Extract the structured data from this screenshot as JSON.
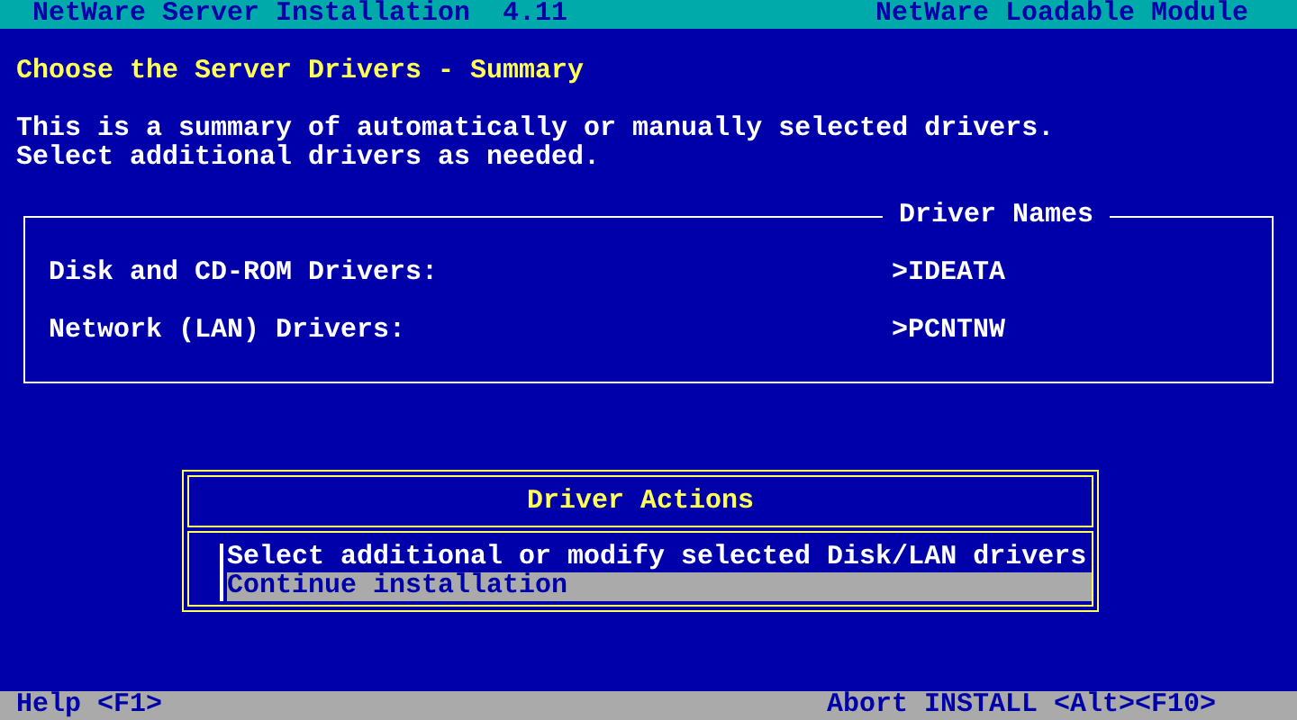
{
  "header": {
    "title": "NetWare Server Installation  4.11",
    "module": "NetWare Loadable Module"
  },
  "heading": "Choose the Server Drivers - Summary",
  "description": [
    "This is a summary of automatically or manually selected drivers.",
    "Select additional drivers as needed."
  ],
  "driver_names": {
    "title": "Driver Names",
    "rows": [
      {
        "label": "Disk and CD-ROM Drivers:",
        "value": ">IDEATA"
      },
      {
        "label": "Network (LAN) Drivers:",
        "value": ">PCNTNW"
      }
    ]
  },
  "actions_menu": {
    "title": "Driver Actions",
    "items": [
      {
        "label": "Select additional or modify selected Disk/LAN drivers",
        "selected": false
      },
      {
        "label": "Continue installation",
        "selected": true
      }
    ]
  },
  "status_bar": {
    "help": "Help <F1>",
    "abort": "Abort INSTALL <Alt><F10>"
  }
}
